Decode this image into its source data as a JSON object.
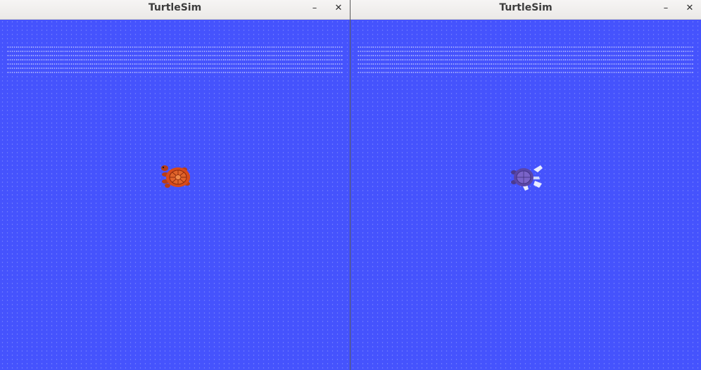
{
  "windows": [
    {
      "title": "TurtleSim",
      "minimize_glyph": "–",
      "close_glyph": "✕",
      "background": "#4553fd",
      "turtle": {
        "icon": "turtle-icon",
        "shell_color": "#d84a1a",
        "limb_color": "#b83d16"
      }
    },
    {
      "title": "TurtleSim",
      "minimize_glyph": "–",
      "close_glyph": "✕",
      "background": "#4553fd",
      "turtle": {
        "icon": "turtle-icon",
        "shell_color": "#6a55b8",
        "limb_color": "#e8ecff"
      }
    }
  ]
}
